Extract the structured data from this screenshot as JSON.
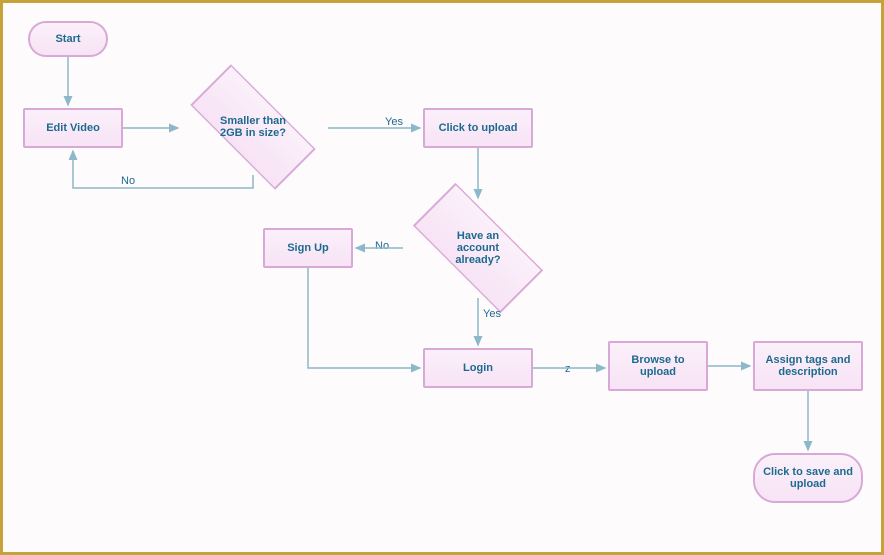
{
  "flowchart": {
    "nodes": {
      "start": {
        "label": "Start",
        "type": "terminator"
      },
      "edit_video": {
        "label": "Edit Video",
        "type": "process"
      },
      "check_size": {
        "label": "Smaller than 2GB in size?",
        "type": "decision"
      },
      "click_upload": {
        "label": "Click to upload",
        "type": "process"
      },
      "have_account": {
        "label": "Have an account already?",
        "type": "decision"
      },
      "sign_up": {
        "label": "Sign Up",
        "type": "process"
      },
      "login": {
        "label": "Login",
        "type": "process"
      },
      "browse": {
        "label": "Browse to upload",
        "type": "process"
      },
      "assign_tags": {
        "label": "Assign tags and description",
        "type": "process"
      },
      "save_upload": {
        "label": "Click to save and upload",
        "type": "terminator"
      }
    },
    "edge_labels": {
      "size_yes": "Yes",
      "size_no": "No",
      "account_yes": "Yes",
      "account_no": "No",
      "login_to_browse": "z"
    },
    "edges": [
      {
        "from": "start",
        "to": "edit_video"
      },
      {
        "from": "edit_video",
        "to": "check_size"
      },
      {
        "from": "check_size",
        "to": "click_upload",
        "label_key": "size_yes"
      },
      {
        "from": "check_size",
        "to": "edit_video",
        "label_key": "size_no"
      },
      {
        "from": "click_upload",
        "to": "have_account"
      },
      {
        "from": "have_account",
        "to": "sign_up",
        "label_key": "account_no"
      },
      {
        "from": "have_account",
        "to": "login",
        "label_key": "account_yes"
      },
      {
        "from": "sign_up",
        "to": "login"
      },
      {
        "from": "login",
        "to": "browse",
        "label_key": "login_to_browse"
      },
      {
        "from": "browse",
        "to": "assign_tags"
      },
      {
        "from": "assign_tags",
        "to": "save_upload"
      }
    ]
  }
}
